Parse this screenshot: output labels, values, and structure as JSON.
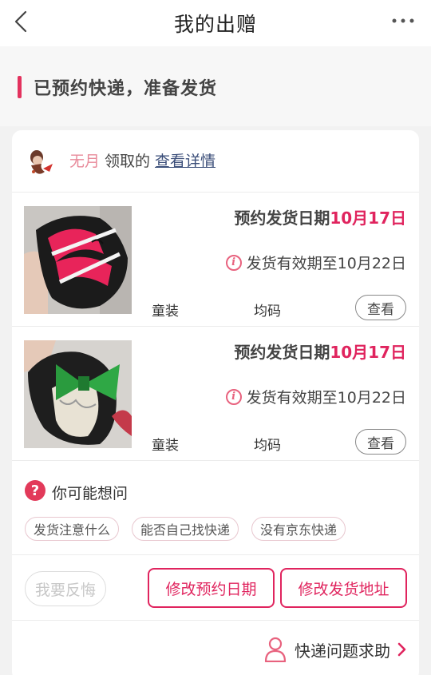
{
  "header": {
    "title": "我的出赠"
  },
  "status": {
    "text": "已预约快递，准备发货"
  },
  "receiver": {
    "name": "无月",
    "action": "领取的",
    "link": "查看详情"
  },
  "items": [
    {
      "date_prefix": "预约发货日期",
      "date_value": "10月17日",
      "expiry": "发货有效期至10月22日",
      "category": "童装",
      "size": "均码",
      "view_label": "查看",
      "thumb_icon": "red-shoe-photo"
    },
    {
      "date_prefix": "预约发货日期",
      "date_value": "10月17日",
      "expiry": "发货有效期至10月22日",
      "category": "童装",
      "size": "均码",
      "view_label": "查看",
      "thumb_icon": "green-bow-shoe-photo"
    }
  ],
  "faq": {
    "title": "你可能想问",
    "chips": [
      "发货注意什么",
      "能否自己找快递",
      "没有京东快递"
    ]
  },
  "actions": {
    "regret": "我要反悔",
    "change_date": "修改预约日期",
    "change_address": "修改发货地址"
  },
  "help": {
    "label": "快递问题求助"
  },
  "colors": {
    "accent": "#e0245e",
    "link": "#3b4e79",
    "receiver_name": "#e88a9a"
  }
}
